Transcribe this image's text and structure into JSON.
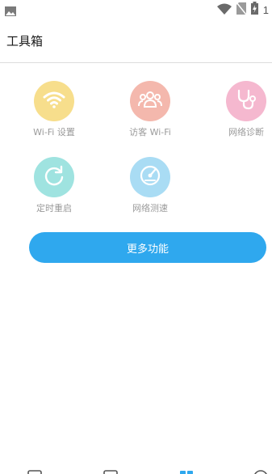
{
  "status_bar": {
    "time": "1",
    "icons": [
      "image-icon",
      "wifi-icon",
      "no-sim-icon",
      "battery-charging-icon"
    ]
  },
  "header": {
    "title": "工具箱"
  },
  "tools": [
    {
      "label": "Wi-Fi 设置",
      "icon": "wifi-icon",
      "color": "#f7de8c"
    },
    {
      "label": "访客 Wi-Fi",
      "icon": "guests-icon",
      "color": "#f4b8ad"
    },
    {
      "label": "网络诊断",
      "icon": "stethoscope-icon",
      "color": "#f5b8cf"
    },
    {
      "label": "定时重启",
      "icon": "restart-icon",
      "color": "#9fe3e0"
    },
    {
      "label": "网络测速",
      "icon": "speedometer-icon",
      "color": "#a9dcf4"
    }
  ],
  "more_button": {
    "label": "更多功能",
    "color": "#2fa8ee"
  },
  "bottom_nav": {
    "icons": [
      "home-icon",
      "device-icon",
      "toolbox-icon",
      "profile-icon"
    ],
    "active_color": "#2fa8ee"
  }
}
